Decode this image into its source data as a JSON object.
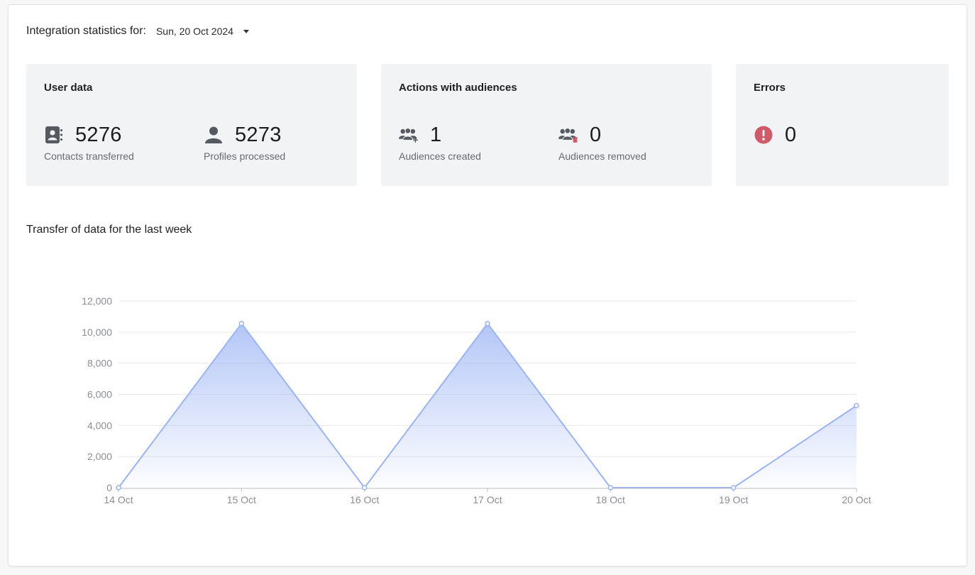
{
  "header": {
    "label": "Integration statistics for:",
    "selected_date": "Sun, 20 Oct 2024"
  },
  "cards": {
    "user_data": {
      "title": "User data",
      "contacts_value": "5276",
      "contacts_label": "Contacts transferred",
      "profiles_value": "5273",
      "profiles_label": "Profiles processed"
    },
    "audiences": {
      "title": "Actions with audiences",
      "created_value": "1",
      "created_label": "Audiences created",
      "removed_value": "0",
      "removed_label": "Audiences removed"
    },
    "errors": {
      "title": "Errors",
      "value": "0"
    }
  },
  "colors": {
    "line": "#9bb4f4",
    "error": "#cf5a68",
    "icon": "#555a61"
  },
  "icons": {
    "contacts": "address-book-icon",
    "profiles": "user-icon",
    "created": "users-plus-icon",
    "removed": "users-trash-icon",
    "errors": "exclamation-circle-icon"
  },
  "chart_data": {
    "type": "area",
    "title": "Transfer of data for the last week",
    "x": [
      "14 Oct",
      "15 Oct",
      "16 Oct",
      "17 Oct",
      "18 Oct",
      "19 Oct",
      "20 Oct"
    ],
    "series": [
      {
        "values": [
          0,
          10550,
          0,
          10550,
          0,
          0,
          5276
        ]
      }
    ],
    "yticks": [
      "0",
      "2,000",
      "4,000",
      "6,000",
      "8,000",
      "10,000",
      "12,000"
    ],
    "ylim": [
      0,
      12000
    ],
    "grid": true,
    "legend": "none"
  }
}
